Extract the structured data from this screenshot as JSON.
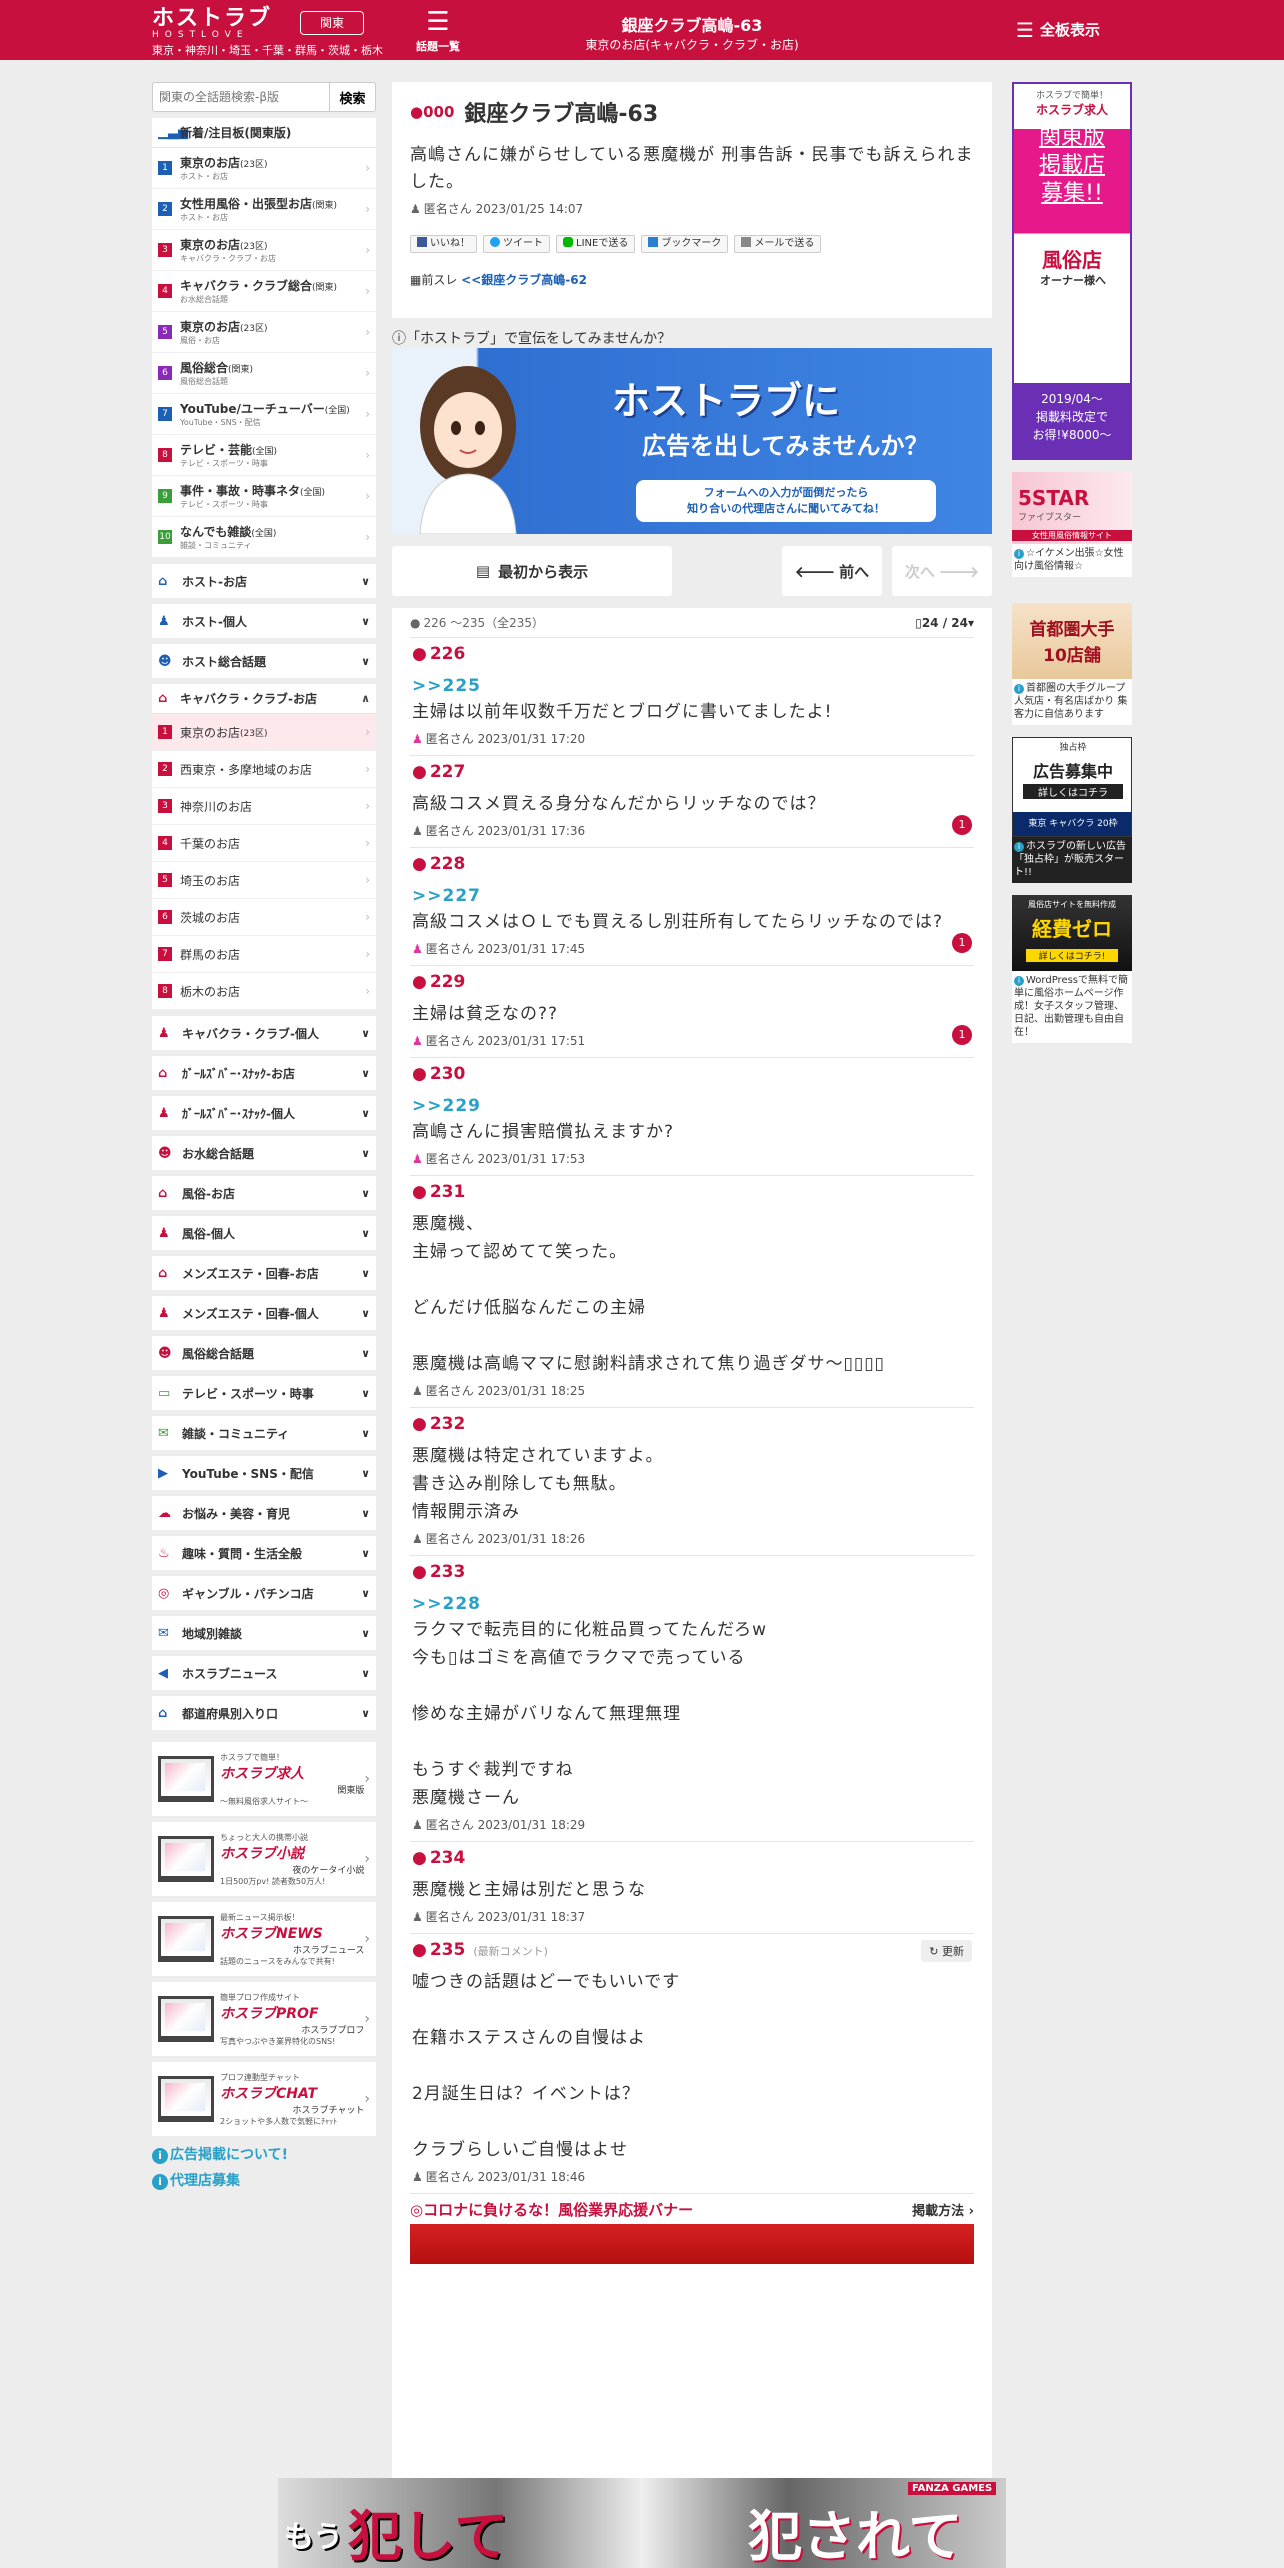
{
  "header": {
    "logo_main": "ホストラブ",
    "logo_sub": "HOSTLOVE",
    "region_button": "関東",
    "region_sub": "東京・神奈川・埼玉・千葉・群馬・茨城・栃木",
    "topics_label": "話題一覧",
    "title": "銀座クラブ高嶋-63",
    "subtitle": "東京のお店(キャバクラ・クラブ・お店)",
    "all_boards": "全板表示"
  },
  "search": {
    "placeholder": "関東の全話題検索-β版",
    "button": "検索"
  },
  "ranking": {
    "title": "新着/注目板(関東版)",
    "items": [
      {
        "num": "1",
        "name": "東京のお店",
        "tag": "(23区)",
        "sub": "ホスト・お店",
        "color": "#1d5fb4"
      },
      {
        "num": "2",
        "name": "女性用風俗・出張型お店",
        "tag": "(関東)",
        "sub": "ホスト・お店",
        "color": "#1d5fb4"
      },
      {
        "num": "3",
        "name": "東京のお店",
        "tag": "(23区)",
        "sub": "キャバクラ・クラブ・お店",
        "color": "#c8103f"
      },
      {
        "num": "4",
        "name": "キャバクラ・クラブ総合",
        "tag": "(関東)",
        "sub": "お水総合話題",
        "color": "#c8103f"
      },
      {
        "num": "5",
        "name": "東京のお店",
        "tag": "(23区)",
        "sub": "風俗・お店",
        "color": "#8a2bb8"
      },
      {
        "num": "6",
        "name": "風俗総合",
        "tag": "(関東)",
        "sub": "風俗総合話題",
        "color": "#8a2bb8"
      },
      {
        "num": "7",
        "name": "YouTube/ユーチューバー",
        "tag": "(全国)",
        "sub": "YouTube・SNS・配信",
        "color": "#1d5fb4"
      },
      {
        "num": "8",
        "name": "テレビ・芸能",
        "tag": "(全国)",
        "sub": "テレビ・スポーツ・時事",
        "color": "#c8103f"
      },
      {
        "num": "9",
        "name": "事件・事故・時事ネタ",
        "tag": "(全国)",
        "sub": "テレビ・スポーツ・時事",
        "color": "#3a9e3a"
      },
      {
        "num": "10",
        "name": "なんでも雑談",
        "tag": "(全国)",
        "sub": "雑談・コミュニティ",
        "color": "#3a9e3a"
      }
    ]
  },
  "categories_top": [
    {
      "label": "ホスト-お店",
      "icon": "⌂"
    },
    {
      "label": "ホスト-個人",
      "icon": "♟"
    },
    {
      "label": "ホスト総合話題",
      "icon": "☻"
    }
  ],
  "kyaba": {
    "title": "キャバクラ・クラブ-お店",
    "items": [
      {
        "num": "1",
        "label": "東京のお店",
        "tag": "(23区)",
        "active": true
      },
      {
        "num": "2",
        "label": "西東京・多摩地域のお店",
        "tag": ""
      },
      {
        "num": "3",
        "label": "神奈川のお店",
        "tag": ""
      },
      {
        "num": "4",
        "label": "千葉のお店",
        "tag": ""
      },
      {
        "num": "5",
        "label": "埼玉のお店",
        "tag": ""
      },
      {
        "num": "6",
        "label": "茨城のお店",
        "tag": ""
      },
      {
        "num": "7",
        "label": "群馬のお店",
        "tag": ""
      },
      {
        "num": "8",
        "label": "栃木のお店",
        "tag": ""
      }
    ]
  },
  "categories_bottom": [
    {
      "label": "キャバクラ・クラブ-個人",
      "icon": "♟",
      "cls": "pink"
    },
    {
      "label": "ｶﾞｰﾙｽﾞﾊﾞｰ･ｽﾅｯｸ-お店",
      "icon": "⌂",
      "cls": "pink"
    },
    {
      "label": "ｶﾞｰﾙｽﾞﾊﾞｰ･ｽﾅｯｸ-個人",
      "icon": "♟",
      "cls": "pink"
    },
    {
      "label": "お水総合話題",
      "icon": "☻",
      "cls": "pink"
    },
    {
      "label": "風俗-お店",
      "icon": "⌂",
      "cls": "pink"
    },
    {
      "label": "風俗-個人",
      "icon": "♟",
      "cls": "pink"
    },
    {
      "label": "メンズエステ・回春-お店",
      "icon": "⌂",
      "cls": "pink"
    },
    {
      "label": "メンズエステ・回春-個人",
      "icon": "♟",
      "cls": "pink"
    },
    {
      "label": "風俗総合話題",
      "icon": "☻",
      "cls": "pink"
    },
    {
      "label": "テレビ・スポーツ・時事",
      "icon": "▭",
      "cls": "green"
    },
    {
      "label": "雑談・コミュニティ",
      "icon": "✉",
      "cls": "green"
    },
    {
      "label": "YouTube・SNS・配信",
      "icon": "▶",
      "cls": ""
    },
    {
      "label": "お悩み・美容・育児",
      "icon": "☁",
      "cls": "pink"
    },
    {
      "label": "趣味・質問・生活全般",
      "icon": "♨",
      "cls": "pink"
    },
    {
      "label": "ギャンブル・パチンコ店",
      "icon": "◎",
      "cls": "pink"
    },
    {
      "label": "地域別雑談",
      "icon": "✉",
      "cls": ""
    },
    {
      "label": "ホスラブニュース",
      "icon": "◀",
      "cls": ""
    },
    {
      "label": "都道府県別入り口",
      "icon": "⌂",
      "cls": ""
    }
  ],
  "promos": [
    {
      "s1": "ホスラブで簡単！",
      "s2": "ホスラブ求人",
      "s3": "関東版",
      "s4": "〜無料風俗求人サイト〜"
    },
    {
      "s1": "ちょっと大人の携帯小説",
      "s2": "ホスラブ小説",
      "s3": "夜のケータイ小説",
      "s4": "1日500万pv! 読者数50万人!"
    },
    {
      "s1": "最新ニュース掲示板！",
      "s2": "ホスラブNEWS",
      "s3": "ホスラブニュース",
      "s4": "話題のニュースをみんなで共有!"
    },
    {
      "s1": "簡単プロフ作成サイト",
      "s2": "ホスラブPROF",
      "s3": "ホスラブプロフ",
      "s4": "写真やつぶやき業界特化のSNS!"
    },
    {
      "s1": "プロフ連動型チャット",
      "s2": "ホスラブCHAT",
      "s3": "ホスラブチャット",
      "s4": "2ショットや多人数で気軽にﾁｬｯﾄ"
    }
  ],
  "side_links": [
    "広告掲載について!",
    "代理店募集"
  ],
  "thread": {
    "num": "000",
    "title": "銀座クラブ高嶋-63",
    "body": "高嶋さんに嫌がらせしている悪魔機が 刑事告訴・民事でも訴えられました。",
    "author": "匿名さん",
    "date": "2023/01/25 14:07",
    "share": [
      "いいね！",
      "ツイート",
      "LINEで送る",
      "ブックマーク",
      "メールで送る"
    ],
    "prev_label": "前スレ ",
    "prev_link": "<<銀座クラブ高嶋-62"
  },
  "ad": {
    "heading": "「ホストラブ」で宣伝をしてみませんか？",
    "line1": "ホストラブに",
    "line2": "広告を出してみませんか？",
    "box1": "フォームへの入力が面倒だったら",
    "box2": "知り合いの代理店さんに聞いてみてね！"
  },
  "nav": {
    "first": "最初から表示",
    "prev": "前へ",
    "next": "次へ"
  },
  "posts_header": {
    "range": "226 ～235（全235）",
    "page": "24 / 24"
  },
  "posts": [
    {
      "num": "226",
      "reply": ">>225",
      "body": "主婦は以前年収数千万だとブログに書いてましたよ!",
      "author": "匿名さん",
      "date": "2023/01/31 17:20",
      "female": true,
      "badge": ""
    },
    {
      "num": "227",
      "reply": "",
      "body": "高級コスメ買える身分なんだからリッチなのでは？",
      "author": "匿名さん",
      "date": "2023/01/31 17:36",
      "female": false,
      "badge": "1"
    },
    {
      "num": "228",
      "reply": ">>227",
      "body": "高級コスメはＯＬでも買えるし別荘所有してたらリッチなのでは?",
      "author": "匿名さん",
      "date": "2023/01/31 17:45",
      "female": true,
      "badge": "1"
    },
    {
      "num": "229",
      "reply": "",
      "body": "主婦は貧乏なの??",
      "author": "匿名さん",
      "date": "2023/01/31 17:51",
      "female": true,
      "badge": "1"
    },
    {
      "num": "230",
      "reply": ">>229",
      "body": "高嶋さんに損害賠償払えますか?",
      "author": "匿名さん",
      "date": "2023/01/31 17:53",
      "female": true,
      "badge": ""
    },
    {
      "num": "231",
      "reply": "",
      "body": "悪魔機、\n主婦って認めてて笑った。\n\nどんだけ低脳なんだこの主婦\n\n悪魔機は高嶋ママに慰謝料請求されて焦り過ぎダサ〜▯▯▯▯",
      "author": "匿名さん",
      "date": "2023/01/31 18:25",
      "female": false,
      "badge": ""
    },
    {
      "num": "232",
      "reply": "",
      "body": "悪魔機は特定されていますよ。\n書き込み削除しても無駄。\n情報開示済み",
      "author": "匿名さん",
      "date": "2023/01/31 18:26",
      "female": false,
      "badge": ""
    },
    {
      "num": "233",
      "reply": ">>228",
      "body": "ラクマで転売目的に化粧品買ってたんだろw\n今も▯はゴミを高値でラクマで売っている\n\n惨めな主婦がバリなんて無理無理\n\nもうすぐ裁判ですね\n悪魔機さーん",
      "author": "匿名さん",
      "date": "2023/01/31 18:29",
      "female": false,
      "badge": ""
    },
    {
      "num": "234",
      "reply": "",
      "body": "悪魔機と主婦は別だと思うな",
      "author": "匿名さん",
      "date": "2023/01/31 18:37",
      "female": false,
      "badge": ""
    },
    {
      "num": "235",
      "reply": "",
      "body": "嘘つきの話題はどーでもいいです\n\n在籍ホステスさんの自慢はよ\n\n2月誕生日は？イベントは？\n\nクラブらしいご自慢はよせ",
      "author": "匿名さん",
      "date": "2023/01/31 18:46",
      "female": false,
      "badge": "",
      "latest": "(最新コメント)",
      "refresh": "更新"
    }
  ],
  "corona": {
    "label": "◎コロナに負けるな！風俗業界応援バナー",
    "more": "掲載方法"
  },
  "right_ads": [
    {
      "lines": [
        "ホスラブで簡単！",
        "ホスラブ求人"
      ],
      "big": [
        "関東版",
        "掲載店",
        "募集!!"
      ],
      "badge": "風俗店",
      "badge2": "オーナー様へ",
      "foot": [
        "2019/04〜",
        "掲載料改定で",
        "お得!¥8000〜"
      ],
      "caption": ""
    },
    {
      "title": "5STAR",
      "sub": "ファイブスター",
      "foot": "女性用風俗情報サイト",
      "caption": "☆イケメン出張☆女性向け風俗情報☆"
    },
    {
      "title": "首都圏大手",
      "sub": "10店舗",
      "caption": "首都圏の大手グループ 人気店・有名店ばかり 集客力に自信あります"
    },
    {
      "title": "広告募集中",
      "sub": "詳しくはコチラ",
      "tag": "独占枠",
      "foot": "東京 キャバクラ 20枠",
      "caption": "ホスラブの新しい広告「独占枠」が販売スタート!!"
    },
    {
      "title": "経費ゼロ",
      "sub": "詳しくはコチラ!",
      "tag": "風俗店サイトを無料作成",
      "caption": "WordPressで無料で簡単に風俗ホームページ作成！女子スタッフ管理、日記、出勤管理も自由自在！"
    }
  ],
  "bottom_ad": {
    "left": "もう",
    "big1": "犯して",
    "big2": "犯されて",
    "brand": "FANZA GAMES"
  }
}
